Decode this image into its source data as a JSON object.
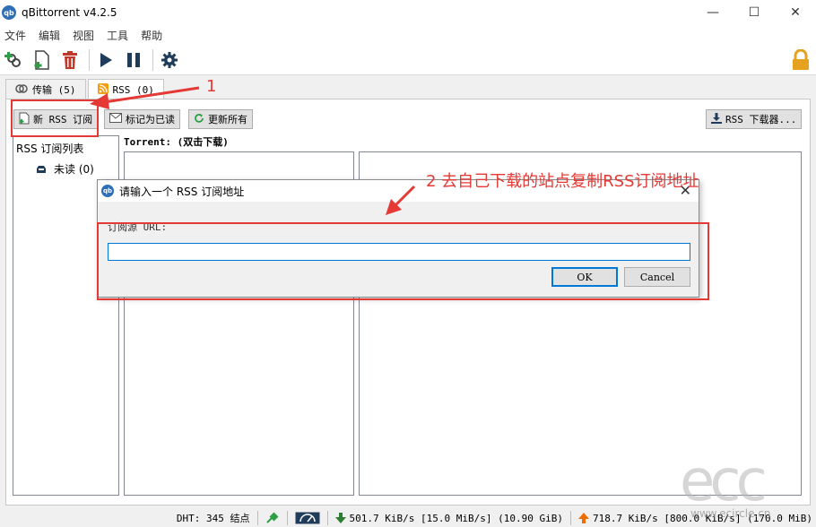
{
  "window": {
    "title": "qBittorrent v4.2.5",
    "logo_text": "qb",
    "minimize": "—",
    "maximize": "☐",
    "close": "✕"
  },
  "menu": [
    "文件",
    "编辑",
    "视图",
    "工具",
    "帮助"
  ],
  "tabs": [
    {
      "label": "传输 (5)"
    },
    {
      "label": "RSS (0)"
    }
  ],
  "rss_toolbar": {
    "new_feed": "新 RSS 订阅",
    "mark_read": "标记为已读",
    "update_all": "更新所有",
    "downloader": "RSS 下载器..."
  },
  "feeds": {
    "root": "RSS 订阅列表",
    "unread": "未读 (0)"
  },
  "torrent_header": "Torrent: (双击下载)",
  "dialog": {
    "title": "请输入一个 RSS 订阅地址",
    "label": "订阅源 URL:",
    "value": "",
    "ok": "OK",
    "cancel": "Cancel"
  },
  "annotations": {
    "step1": "1",
    "step2": "2 去自己下载的站点复制RSS订阅地址"
  },
  "status": {
    "dht": "DHT: 345 结点",
    "download": "501.7 KiB/s [15.0 MiB/s] (10.90 GiB)",
    "upload": "718.7 KiB/s [800.0 KiB/s] (170.0 MiB)"
  },
  "watermark": {
    "logo": "ecc",
    "url": "www.ecircle.cn"
  },
  "colors": {
    "annotation": "#e53935",
    "accent": "#0078d7",
    "download": "#2e7d32",
    "upload": "#ef6c00"
  }
}
